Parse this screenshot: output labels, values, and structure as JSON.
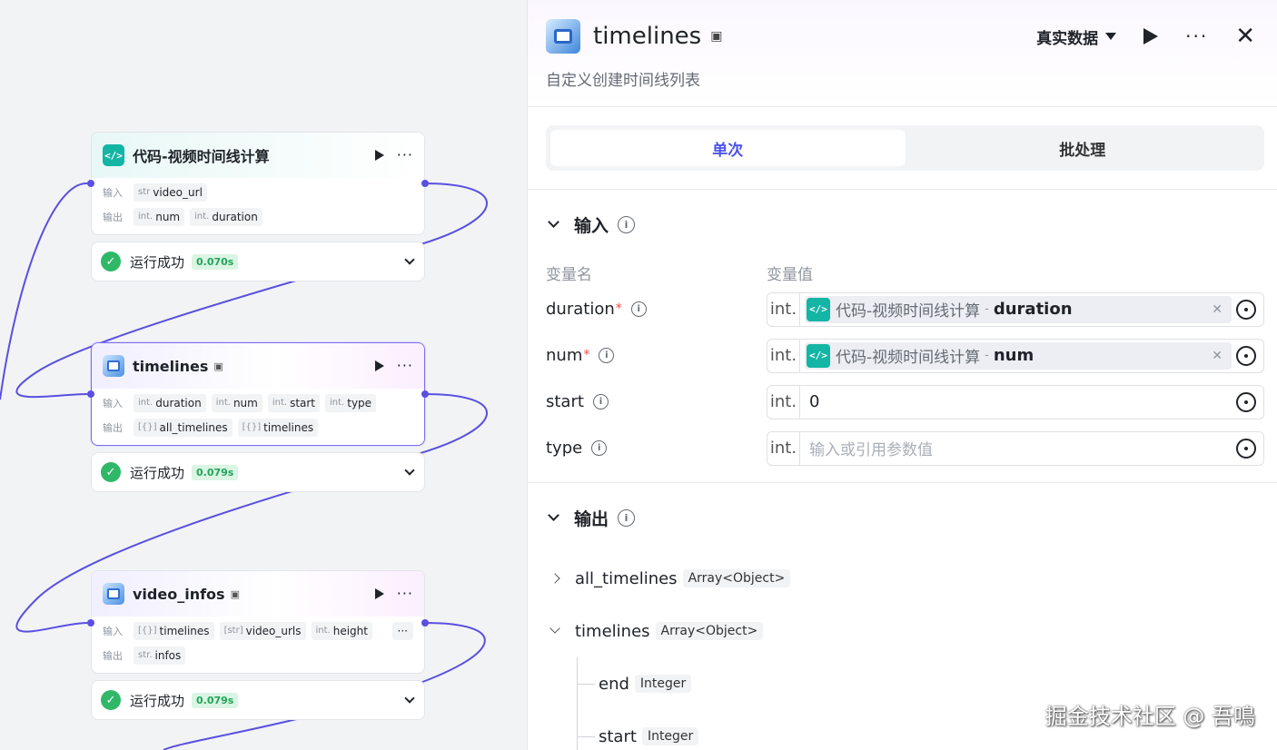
{
  "canvas": {
    "io_input_label": "输入",
    "io_output_label": "输出",
    "nodes": [
      {
        "title": "代码-视频时间线计算",
        "inputs": [
          {
            "type": "str",
            "name": "video_url"
          }
        ],
        "outputs": [
          {
            "type": "int.",
            "name": "num"
          },
          {
            "type": "int.",
            "name": "duration"
          }
        ],
        "status": "运行成功",
        "time": "0.070s"
      },
      {
        "title": "timelines",
        "inputs": [
          {
            "type": "int.",
            "name": "duration"
          },
          {
            "type": "int.",
            "name": "num"
          },
          {
            "type": "int.",
            "name": "start"
          },
          {
            "type": "int.",
            "name": "type"
          }
        ],
        "outputs": [
          {
            "type": "[{}]",
            "name": "all_timelines"
          },
          {
            "type": "[{}]",
            "name": "timelines"
          }
        ],
        "status": "运行成功",
        "time": "0.079s"
      },
      {
        "title": "video_infos",
        "inputs": [
          {
            "type": "[{}]",
            "name": "timelines"
          },
          {
            "type": "[str]",
            "name": "video_urls"
          },
          {
            "type": "int.",
            "name": "height"
          }
        ],
        "inputs_more": "···",
        "outputs": [
          {
            "type": "str.",
            "name": "infos"
          }
        ],
        "status": "运行成功",
        "time": "0.079s"
      }
    ]
  },
  "panel": {
    "title": "timelines",
    "description": "自定义创建时间线列表",
    "data_select": "真实数据",
    "close": "✕",
    "tabs": [
      {
        "label": "单次",
        "active": true
      },
      {
        "label": "批处理",
        "active": false
      }
    ],
    "input_section": {
      "title": "输入",
      "col_name": "变量名",
      "col_value": "变量值",
      "rows": [
        {
          "name": "duration",
          "required": true,
          "type": "int.",
          "ref_node": "代码-视频时间线计算",
          "ref_sep": "-",
          "ref_field": "duration"
        },
        {
          "name": "num",
          "required": true,
          "type": "int.",
          "ref_node": "代码-视频时间线计算",
          "ref_sep": "-",
          "ref_field": "num"
        },
        {
          "name": "start",
          "required": false,
          "type": "int.",
          "value": "0"
        },
        {
          "name": "type",
          "required": false,
          "type": "int.",
          "placeholder": "输入或引用参数值"
        }
      ]
    },
    "output_section": {
      "title": "输出",
      "items": [
        {
          "name": "all_timelines",
          "type": "Array<Object>",
          "expanded": false
        },
        {
          "name": "timelines",
          "type": "Array<Object>",
          "expanded": true,
          "children": [
            {
              "name": "end",
              "type": "Integer"
            },
            {
              "name": "start",
              "type": "Integer"
            }
          ]
        }
      ]
    }
  },
  "watermark": "掘金技术社区 @ 吾鳴"
}
